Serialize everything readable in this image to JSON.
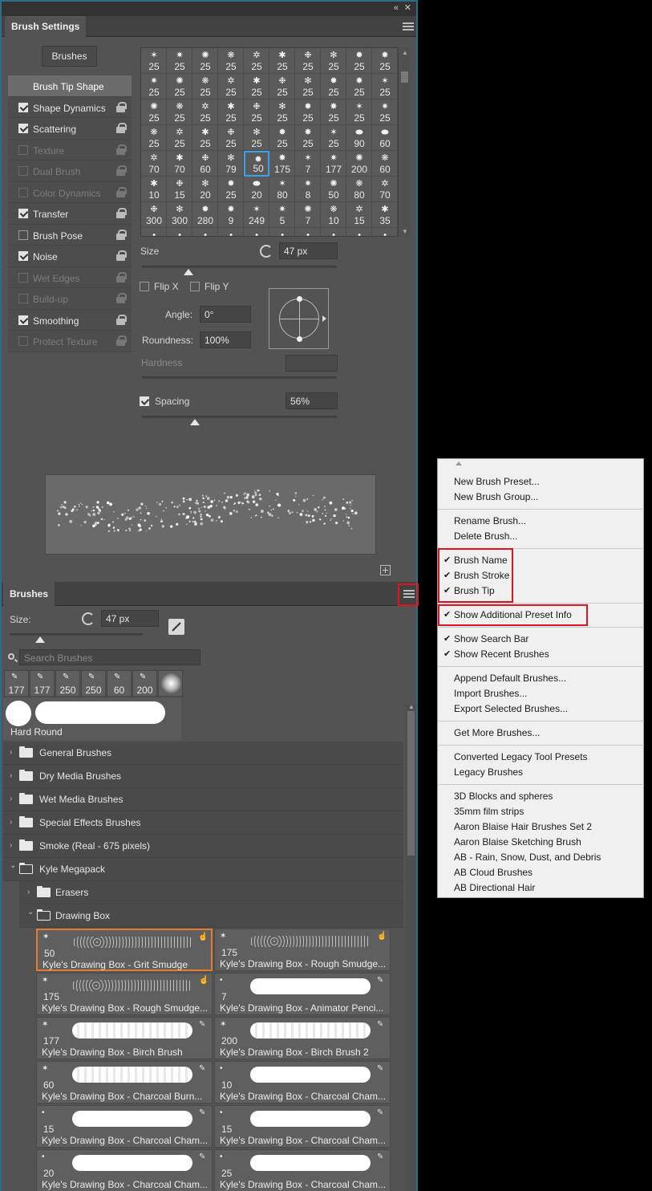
{
  "brush_settings": {
    "title": "Brush Settings",
    "brushes_button": "Brushes",
    "options": [
      {
        "label": "Brush Tip Shape",
        "checkbox": null,
        "enabled": true,
        "selected": true
      },
      {
        "label": "Shape Dynamics",
        "checkbox": true,
        "enabled": true
      },
      {
        "label": "Scattering",
        "checkbox": true,
        "enabled": true
      },
      {
        "label": "Texture",
        "checkbox": false,
        "enabled": false
      },
      {
        "label": "Dual Brush",
        "checkbox": false,
        "enabled": false
      },
      {
        "label": "Color Dynamics",
        "checkbox": false,
        "enabled": false
      },
      {
        "label": "Transfer",
        "checkbox": true,
        "enabled": true
      },
      {
        "label": "Brush Pose",
        "checkbox": false,
        "enabled": true
      },
      {
        "label": "Noise",
        "checkbox": true,
        "enabled": true
      },
      {
        "label": "Wet Edges",
        "checkbox": false,
        "enabled": false
      },
      {
        "label": "Build-up",
        "checkbox": false,
        "enabled": false
      },
      {
        "label": "Smoothing",
        "checkbox": true,
        "enabled": true
      },
      {
        "label": "Protect Texture",
        "checkbox": false,
        "enabled": false
      }
    ],
    "tip_sizes": [
      [
        "25",
        "25",
        "25",
        "25",
        "25",
        "25",
        "25",
        "25",
        "25",
        "25"
      ],
      [
        "25",
        "25",
        "25",
        "25",
        "25",
        "25",
        "25",
        "25",
        "25",
        "25"
      ],
      [
        "25",
        "25",
        "25",
        "25",
        "25",
        "25",
        "25",
        "25",
        "25",
        "25"
      ],
      [
        "25",
        "25",
        "25",
        "25",
        "25",
        "25",
        "25",
        "25",
        "90",
        "60"
      ],
      [
        "70",
        "70",
        "60",
        "79",
        "50",
        "175",
        "7",
        "177",
        "200",
        "60"
      ],
      [
        "10",
        "15",
        "20",
        "25",
        "20",
        "80",
        "8",
        "50",
        "80",
        "70"
      ],
      [
        "300",
        "300",
        "280",
        "9",
        "249",
        "5",
        "7",
        "10",
        "15",
        "35"
      ]
    ],
    "selected_tip": "50",
    "size_label": "Size",
    "size_value": "47 px",
    "flip_x": "Flip X",
    "flip_y": "Flip Y",
    "angle_label": "Angle:",
    "angle_value": "0°",
    "roundness_label": "Roundness:",
    "roundness_value": "100%",
    "hardness_label": "Hardness",
    "spacing_label": "Spacing",
    "spacing_value": "56%",
    "size_slider_fraction": 0.24,
    "spacing_slider_fraction": 0.27
  },
  "brushes_panel": {
    "title": "Brushes",
    "size_label": "Size:",
    "size_value": "47 px",
    "search_placeholder": "Search Brushes",
    "recent": [
      "177",
      "177",
      "250",
      "250",
      "60",
      "200",
      ""
    ],
    "hard_round_label": "Hard Round",
    "tree": [
      {
        "label": "General Brushes",
        "level": 0,
        "open": false
      },
      {
        "label": "Dry Media Brushes",
        "level": 0,
        "open": false
      },
      {
        "label": "Wet Media Brushes",
        "level": 0,
        "open": false
      },
      {
        "label": "Special Effects Brushes",
        "level": 0,
        "open": false
      },
      {
        "label": "Smoke (Real - 675 pixels)",
        "level": 0,
        "open": false
      },
      {
        "label": "Kyle Megapack",
        "level": 0,
        "open": true
      },
      {
        "label": "Erasers",
        "level": 1,
        "open": false
      },
      {
        "label": "Drawing Box",
        "level": 1,
        "open": true
      }
    ],
    "presets": [
      {
        "num": "50",
        "name": "Kyle's Drawing Box - Grit Smudge",
        "style": "spray",
        "selected": true
      },
      {
        "num": "175",
        "name": "Kyle's Drawing Box - Rough Smudge...",
        "style": "spray"
      },
      {
        "num": "175",
        "name": "Kyle's Drawing Box - Rough Smudge...",
        "style": "spray"
      },
      {
        "num": "7",
        "name": "Kyle's Drawing Box - Animator Penci...",
        "style": "solid"
      },
      {
        "num": "177",
        "name": "Kyle's Drawing Box - Birch Brush",
        "style": "textured"
      },
      {
        "num": "200",
        "name": "Kyle's Drawing Box - Birch Brush 2",
        "style": "textured"
      },
      {
        "num": "60",
        "name": "Kyle's Drawing Box - Charcoal Burn...",
        "style": "textured"
      },
      {
        "num": "10",
        "name": "Kyle's Drawing Box - Charcoal Cham...",
        "style": "solid"
      },
      {
        "num": "15",
        "name": "Kyle's Drawing Box - Charcoal Cham...",
        "style": "solid"
      },
      {
        "num": "15",
        "name": "Kyle's Drawing Box - Charcoal Cham...",
        "style": "solid"
      },
      {
        "num": "20",
        "name": "Kyle's Drawing Box - Charcoal Cham...",
        "style": "solid"
      },
      {
        "num": "25",
        "name": "Kyle's Drawing Box - Charcoal Cham...",
        "style": "solid"
      }
    ]
  },
  "flyout_menu": {
    "groups": [
      [
        {
          "label": "New Brush Preset...",
          "checked": false
        },
        {
          "label": "New Brush Group...",
          "checked": false
        }
      ],
      [
        {
          "label": "Rename Brush...",
          "checked": false
        },
        {
          "label": "Delete Brush...",
          "checked": false
        }
      ],
      [
        {
          "label": "Brush Name",
          "checked": true
        },
        {
          "label": "Brush Stroke",
          "checked": true
        },
        {
          "label": "Brush Tip",
          "checked": true
        }
      ],
      [
        {
          "label": "Show Additional Preset Info",
          "checked": true
        }
      ],
      [
        {
          "label": "Show Search Bar",
          "checked": true
        },
        {
          "label": "Show Recent Brushes",
          "checked": true
        }
      ],
      [
        {
          "label": "Append Default Brushes...",
          "checked": false
        },
        {
          "label": "Import Brushes...",
          "checked": false
        },
        {
          "label": "Export Selected Brushes...",
          "checked": false
        }
      ],
      [
        {
          "label": "Get More Brushes...",
          "checked": false
        }
      ],
      [
        {
          "label": "Converted Legacy Tool Presets",
          "checked": false
        },
        {
          "label": "Legacy Brushes",
          "checked": false
        }
      ],
      [
        {
          "label": "3D Blocks and spheres",
          "checked": false
        },
        {
          "label": "35mm film strips",
          "checked": false
        },
        {
          "label": "Aaron Blaise Hair Brushes Set 2",
          "checked": false
        },
        {
          "label": "Aaron Blaise Sketching Brush",
          "checked": false
        },
        {
          "label": "AB - Rain, Snow, Dust, and Debris",
          "checked": false
        },
        {
          "label": "AB Cloud Brushes",
          "checked": false
        },
        {
          "label": "AB Directional Hair",
          "checked": false
        }
      ]
    ]
  },
  "colors": {
    "panel_bg": "#535353",
    "highlight_red": "#e0141e",
    "selection_blue": "#3aa0e8",
    "selection_orange": "#e67a2e"
  }
}
